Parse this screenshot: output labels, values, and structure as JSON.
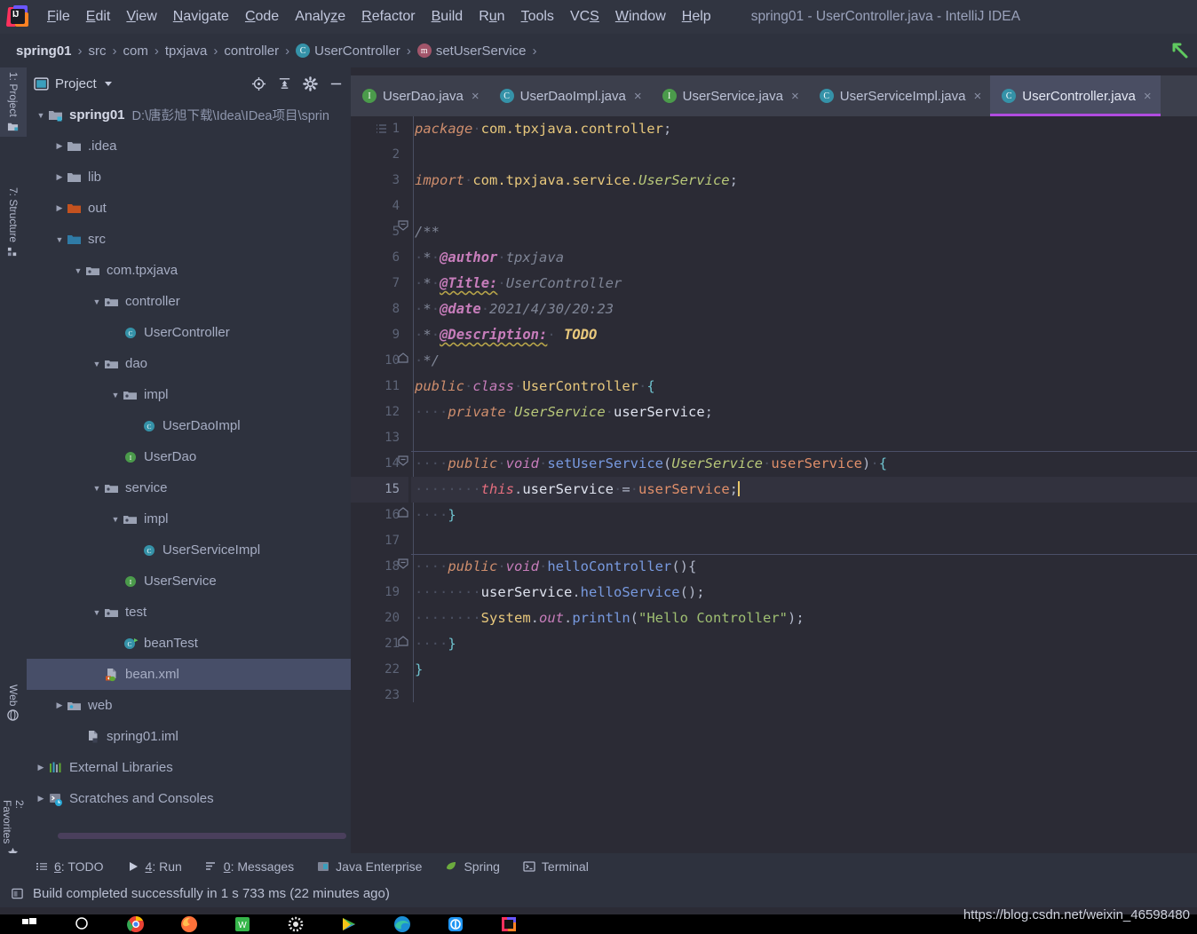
{
  "app": {
    "logo_icon": "intellij-idea-logo",
    "window_title": "spring01 - UserController.java - IntelliJ IDEA"
  },
  "menu": {
    "items": [
      {
        "label": "File",
        "mnemonic": "F"
      },
      {
        "label": "Edit",
        "mnemonic": "E"
      },
      {
        "label": "View",
        "mnemonic": "V"
      },
      {
        "label": "Navigate",
        "mnemonic": "N"
      },
      {
        "label": "Code",
        "mnemonic": "C"
      },
      {
        "label": "Analyze",
        "mnemonic": "z"
      },
      {
        "label": "Refactor",
        "mnemonic": "R"
      },
      {
        "label": "Build",
        "mnemonic": "B"
      },
      {
        "label": "Run",
        "mnemonic": "u"
      },
      {
        "label": "Tools",
        "mnemonic": "T"
      },
      {
        "label": "VCS",
        "mnemonic": "S"
      },
      {
        "label": "Window",
        "mnemonic": "W"
      },
      {
        "label": "Help",
        "mnemonic": "H"
      }
    ]
  },
  "breadcrumb": {
    "separator": "›",
    "items": [
      {
        "label": "spring01",
        "badge": "",
        "root": true
      },
      {
        "label": "src",
        "badge": ""
      },
      {
        "label": "com",
        "badge": ""
      },
      {
        "label": "tpxjava",
        "badge": ""
      },
      {
        "label": "controller",
        "badge": ""
      },
      {
        "label": "UserController",
        "badge": "C"
      },
      {
        "label": "setUserService",
        "badge": "m"
      }
    ],
    "run_icon": "green-arrow-icon"
  },
  "left_strip": {
    "buttons": [
      {
        "label": "1: Project",
        "icon": "project-icon",
        "active": true
      },
      {
        "label": "7: Structure",
        "icon": "structure-icon",
        "active": false
      },
      {
        "label": "Web",
        "icon": "web-icon",
        "active": false
      },
      {
        "label": "2: Favorites",
        "icon": "star-icon",
        "active": false
      }
    ]
  },
  "project_panel": {
    "title": "Project",
    "view_icon": "project-view-icon",
    "dropdown_icon": "chevron-down-icon",
    "tools": [
      {
        "name": "locate-in-tree-icon",
        "glyph": "target"
      },
      {
        "name": "collapse-all-icon",
        "glyph": "collapse"
      },
      {
        "name": "settings-gear-icon",
        "glyph": "gear"
      },
      {
        "name": "hide-panel-icon",
        "glyph": "minus"
      }
    ],
    "tree": [
      {
        "label": "spring01",
        "path": "D:\\唐彭旭下载\\Idea\\IDea项目\\sprin",
        "indent": 0,
        "arrow": "down",
        "icon": "module-folder",
        "bold": true
      },
      {
        "label": ".idea",
        "indent": 1,
        "arrow": "right",
        "icon": "folder-grey"
      },
      {
        "label": "lib",
        "indent": 1,
        "arrow": "right",
        "icon": "folder-grey"
      },
      {
        "label": "out",
        "indent": 1,
        "arrow": "right",
        "icon": "folder-orange"
      },
      {
        "label": "src",
        "indent": 1,
        "arrow": "down",
        "icon": "folder-blue"
      },
      {
        "label": "com.tpxjava",
        "indent": 2,
        "arrow": "down",
        "icon": "package"
      },
      {
        "label": "controller",
        "indent": 3,
        "arrow": "down",
        "icon": "package"
      },
      {
        "label": "UserController",
        "indent": 4,
        "arrow": "none",
        "icon": "class"
      },
      {
        "label": "dao",
        "indent": 3,
        "arrow": "down",
        "icon": "package"
      },
      {
        "label": "impl",
        "indent": 4,
        "arrow": "down",
        "icon": "package"
      },
      {
        "label": "UserDaoImpl",
        "indent": 5,
        "arrow": "none",
        "icon": "class"
      },
      {
        "label": "UserDao",
        "indent": 4,
        "arrow": "none",
        "icon": "interface"
      },
      {
        "label": "service",
        "indent": 3,
        "arrow": "down",
        "icon": "package"
      },
      {
        "label": "impl",
        "indent": 4,
        "arrow": "down",
        "icon": "package"
      },
      {
        "label": "UserServiceImpl",
        "indent": 5,
        "arrow": "none",
        "icon": "class"
      },
      {
        "label": "UserService",
        "indent": 4,
        "arrow": "none",
        "icon": "interface"
      },
      {
        "label": "test",
        "indent": 3,
        "arrow": "down",
        "icon": "package"
      },
      {
        "label": "beanTest",
        "indent": 4,
        "arrow": "none",
        "icon": "class-runnable"
      },
      {
        "label": "bean.xml",
        "indent": 3,
        "arrow": "none",
        "icon": "spring-xml",
        "selected": true
      },
      {
        "label": "web",
        "indent": 1,
        "arrow": "right",
        "icon": "web-folder"
      },
      {
        "label": "spring01.iml",
        "indent": 2,
        "arrow": "none",
        "icon": "iml-file"
      },
      {
        "label": "External Libraries",
        "indent": 0,
        "arrow": "right",
        "icon": "libraries"
      },
      {
        "label": "Scratches and Consoles",
        "indent": 0,
        "arrow": "right",
        "icon": "scratches"
      }
    ]
  },
  "tabs": {
    "close_glyph": "×",
    "items": [
      {
        "label": "UserDao.java",
        "badge": "I",
        "active": false
      },
      {
        "label": "UserDaoImpl.java",
        "badge": "C",
        "active": false
      },
      {
        "label": "UserService.java",
        "badge": "I",
        "active": false
      },
      {
        "label": "UserServiceImpl.java",
        "badge": "C",
        "active": false
      },
      {
        "label": "UserController.java",
        "badge": "C",
        "active": true
      }
    ]
  },
  "editor": {
    "current_line": 15,
    "line_numbers": [
      1,
      2,
      3,
      4,
      5,
      6,
      7,
      8,
      9,
      10,
      11,
      12,
      13,
      14,
      15,
      16,
      17,
      18,
      19,
      20,
      21,
      22,
      23
    ],
    "code_plain": [
      "package com.tpxjava.controller;",
      "",
      "import com.tpxjava.service.UserService;",
      "",
      "/**",
      " * @author tpxjava",
      " * @Title: UserController",
      " * @date 2021/4/30/20:23",
      " * @Description: TODO",
      " */",
      "public class UserController {",
      "    private UserService userService;",
      "",
      "    public void setUserService(UserService userService) {",
      "        this.userService = userService;",
      "    }",
      "",
      "    public void helloController(){",
      "        userService.helloService();",
      "        System.out.println(\"Hello Controller\");",
      "    }",
      "}",
      ""
    ]
  },
  "tool_windows": {
    "items": [
      {
        "label": "6: TODO",
        "icon": "todo-icon"
      },
      {
        "label": "4: Run",
        "icon": "run-icon"
      },
      {
        "label": "0: Messages",
        "icon": "messages-icon"
      },
      {
        "label": "Java Enterprise",
        "icon": "java-enterprise-icon"
      },
      {
        "label": "Spring",
        "icon": "spring-leaf-icon"
      },
      {
        "label": "Terminal",
        "icon": "terminal-icon"
      }
    ]
  },
  "status": {
    "icon": "build-icon",
    "text": "Build completed successfully in 1 s 733 ms (22 minutes ago)"
  },
  "watermark": {
    "text": "https://blog.csdn.net/weixin_46598480"
  },
  "taskbar": {
    "items": [
      {
        "name": "windows-start-icon"
      },
      {
        "name": "search-icon"
      },
      {
        "name": "chrome-icon"
      },
      {
        "name": "firefox-icon"
      },
      {
        "name": "wps-icon"
      },
      {
        "name": "settings-icon"
      },
      {
        "name": "media-player-icon"
      },
      {
        "name": "edge-icon"
      },
      {
        "name": "kugou-icon"
      },
      {
        "name": "intellij-taskbar-icon"
      }
    ]
  },
  "colors": {
    "accent_purple": "#b14ce0",
    "panel_bg": "#2e323e",
    "editor_bg": "#2b2b35",
    "tab_active": "#4a4e63",
    "selection": "#474e68"
  }
}
